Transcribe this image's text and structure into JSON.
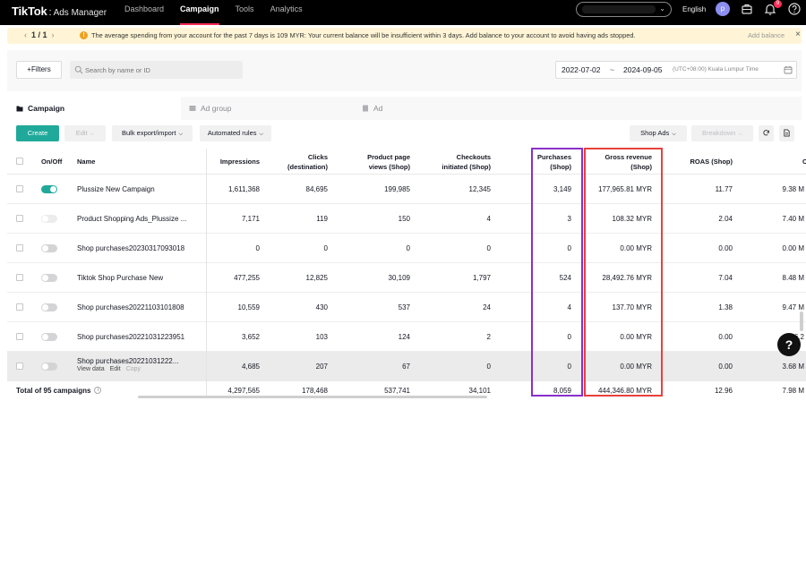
{
  "app": {
    "logo": "TikTok",
    "logo_sep": ":",
    "logo_sub": "Ads Manager"
  },
  "nav": {
    "links": [
      {
        "label": "Dashboard",
        "active": false
      },
      {
        "label": "Campaign",
        "active": true
      },
      {
        "label": "Tools",
        "active": false
      },
      {
        "label": "Analytics",
        "active": false
      }
    ],
    "language": "English",
    "avatar_letter": "p",
    "notification_count": "9"
  },
  "banner": {
    "page": "1 / 1",
    "message": "The average spending from your account for the past 7 days is 109 MYR: Your current balance will be insufficient within 3 days. Add balance to your account to avoid having ads stopped.",
    "action": "Add balance"
  },
  "filters": {
    "filters_label": "+Filters",
    "search_placeholder": "Search by name or ID",
    "date_start": "2022-07-02",
    "date_sep": "~",
    "date_end": "2024-09-05",
    "timezone": "(UTC+08:00) Kuala Lumpur Time"
  },
  "tabs": [
    {
      "label": "Campaign",
      "active": true
    },
    {
      "label": "Ad group",
      "active": false
    },
    {
      "label": "Ad",
      "active": false
    }
  ],
  "toolbar": {
    "create": "Create",
    "edit": "Edit",
    "bulk": "Bulk export/import",
    "automated": "Automated rules",
    "shop_ads": "Shop Ads",
    "breakdown": "Breakdown"
  },
  "table": {
    "headers": {
      "onoff": "On/Off",
      "name": "Name",
      "impressions": "Impressions",
      "clicks_1": "Clicks",
      "clicks_2": "(destination)",
      "ppv_1": "Product page",
      "ppv_2": "views (Shop)",
      "checkouts_1": "Checkouts",
      "checkouts_2": "initiated (Shop)",
      "purchases_1": "Purchases",
      "purchases_2": "(Shop)",
      "revenue_1": "Gross revenue",
      "revenue_2": "(Shop)",
      "roas": "ROAS (Shop)",
      "extra": "C"
    },
    "rows": [
      {
        "status": "on",
        "name": "Plussize New Campaign",
        "impressions": "1,611,368",
        "clicks": "84,695",
        "ppv": "199,985",
        "checkouts": "12,345",
        "purchases": "3,149",
        "revenue": "177,965.81 MYR",
        "roas": "11.77",
        "extra": "9.38 M"
      },
      {
        "status": "disabled",
        "name": "Product Shopping Ads_Plussize ...",
        "impressions": "7,171",
        "clicks": "119",
        "ppv": "150",
        "checkouts": "4",
        "purchases": "3",
        "revenue": "108.32 MYR",
        "roas": "2.04",
        "extra": "7.40 M"
      },
      {
        "status": "off",
        "name": "Shop purchases20230317093018",
        "impressions": "0",
        "clicks": "0",
        "ppv": "0",
        "checkouts": "0",
        "purchases": "0",
        "revenue": "0.00 MYR",
        "roas": "0.00",
        "extra": "0.00 M"
      },
      {
        "status": "off",
        "name": "Tiktok Shop Purchase New",
        "impressions": "477,255",
        "clicks": "12,825",
        "ppv": "30,109",
        "checkouts": "1,797",
        "purchases": "524",
        "revenue": "28,492.76 MYR",
        "roas": "7.04",
        "extra": "8.48 M"
      },
      {
        "status": "off",
        "name": "Shop purchases20221103101808",
        "impressions": "10,559",
        "clicks": "430",
        "ppv": "537",
        "checkouts": "24",
        "purchases": "4",
        "revenue": "137.70 MYR",
        "roas": "1.38",
        "extra": "9.47 M"
      },
      {
        "status": "off",
        "name": "Shop purchases20221031223951",
        "impressions": "3,652",
        "clicks": "103",
        "ppv": "124",
        "checkouts": "2",
        "purchases": "0",
        "revenue": "0.00 MYR",
        "roas": "0.00",
        "extra": "6.2"
      },
      {
        "status": "off",
        "name": "Shop purchases20221031222...",
        "impressions": "4,685",
        "clicks": "207",
        "ppv": "67",
        "checkouts": "0",
        "purchases": "0",
        "revenue": "0.00 MYR",
        "roas": "0.00",
        "extra": "3.68 M"
      }
    ],
    "row_actions": {
      "view": "View data",
      "edit": "Edit",
      "copy": "Copy"
    },
    "total": {
      "label": "Total of 95 campaigns",
      "impressions": "4,297,565",
      "clicks": "178,468",
      "ppv": "537,741",
      "checkouts": "34,101",
      "purchases": "8,059",
      "revenue": "444,346.80 MYR",
      "roas": "12.96",
      "extra": "7.98 M"
    }
  },
  "colors": {
    "accent": "#20a99a",
    "purple_box": "#8b2fc9",
    "red_box": "#e8413b",
    "banner_bg": "#fff5d6"
  }
}
